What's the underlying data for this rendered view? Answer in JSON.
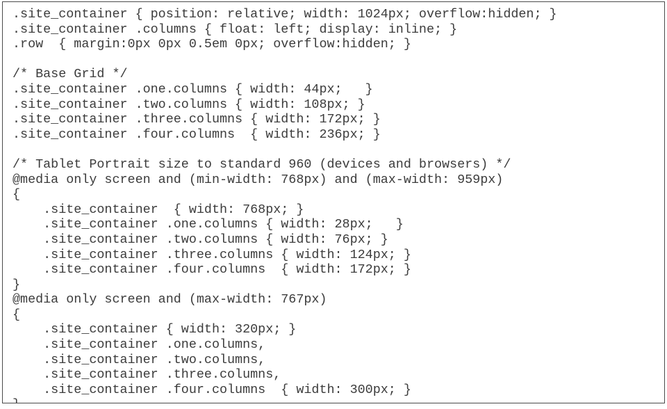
{
  "document": {
    "kind": "css-code-listing",
    "language": "CSS",
    "text_color": "#3c3c3c",
    "background_color": "#ffffff",
    "border_color": "#4a4a4a",
    "lines": [
      ".site_container { position: relative; width: 1024px; overflow:hidden; }",
      ".site_container .columns { float: left; display: inline; }",
      ".row  { margin:0px 0px 0.5em 0px; overflow:hidden; }",
      "",
      "/* Base Grid */",
      ".site_container .one.columns { width: 44px;   }",
      ".site_container .two.columns { width: 108px; }",
      ".site_container .three.columns { width: 172px; }",
      ".site_container .four.columns  { width: 236px; }",
      "",
      "/* Tablet Portrait size to standard 960 (devices and browsers) */",
      "@media only screen and (min-width: 768px) and (max-width: 959px)",
      "{",
      "    .site_container  { width: 768px; }",
      "    .site_container .one.columns { width: 28px;   }",
      "    .site_container .two.columns { width: 76px; }",
      "    .site_container .three.columns { width: 124px; }",
      "    .site_container .four.columns  { width: 172px; }",
      "}",
      "@media only screen and (max-width: 767px)",
      "{",
      "    .site_container { width: 320px; }",
      "    .site_container .one.columns,",
      "    .site_container .two.columns,",
      "    .site_container .three.columns,",
      "    .site_container .four.columns  { width: 300px; }",
      "}"
    ]
  }
}
